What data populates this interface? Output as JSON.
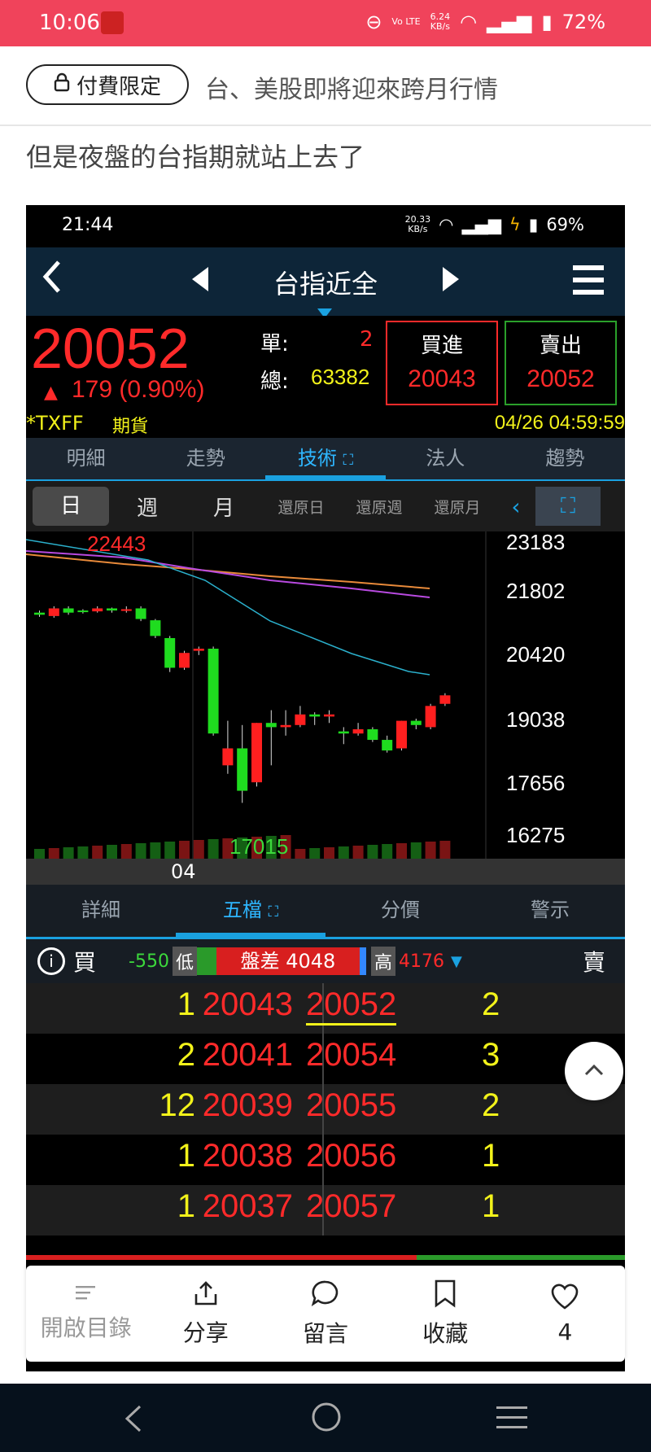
{
  "status": {
    "time": "10:06",
    "net_speed": "6.24",
    "net_unit": "KB/s",
    "volte": "Vo LTE",
    "battery": "72%"
  },
  "article": {
    "badge": "付費限定",
    "title": "台、美股即將迎來跨月行情",
    "text": "但是夜盤的台指期就站上去了"
  },
  "inner_status": {
    "time": "21:44",
    "speed": "20.33",
    "speed_unit": "KB/s",
    "battery": "69%"
  },
  "app": {
    "title": "台指近全",
    "price": "20052",
    "change": "179 (0.90%)",
    "single_label": "單:",
    "single_val": "2",
    "total_label": "總:",
    "total_val": "63382",
    "buy_label": "買進",
    "buy_price": "20043",
    "sell_label": "賣出",
    "sell_price": "20052",
    "symbol": "*TXFF",
    "type": "期貨",
    "datetime": "04/26 04:59:59"
  },
  "tabs": [
    "明細",
    "走勢",
    "技術",
    "法人",
    "趨勢"
  ],
  "periods": [
    "日",
    "週",
    "月",
    "還原日",
    "還原週",
    "還原月"
  ],
  "chart_data": {
    "type": "candlestick",
    "y_ticks": [
      "23183",
      "21802",
      "20420",
      "19038",
      "17656",
      "16275"
    ],
    "annotations": {
      "high": "22443",
      "low": "17015"
    },
    "x_label": "04",
    "candles": [
      {
        "o": 21500,
        "c": 21450,
        "h": 21550,
        "l": 21400
      },
      {
        "o": 21420,
        "c": 21600,
        "h": 21650,
        "l": 21380
      },
      {
        "o": 21600,
        "c": 21500,
        "h": 21650,
        "l": 21450
      },
      {
        "o": 21550,
        "c": 21530,
        "h": 21580,
        "l": 21480
      },
      {
        "o": 21530,
        "c": 21600,
        "h": 21650,
        "l": 21500
      },
      {
        "o": 21600,
        "c": 21550,
        "h": 21620,
        "l": 21500
      },
      {
        "o": 21560,
        "c": 21580,
        "h": 21650,
        "l": 21500
      },
      {
        "o": 21600,
        "c": 21350,
        "h": 21650,
        "l": 21300
      },
      {
        "o": 21320,
        "c": 20950,
        "h": 21350,
        "l": 20900
      },
      {
        "o": 20900,
        "c": 20200,
        "h": 20950,
        "l": 20100
      },
      {
        "o": 20200,
        "c": 20550,
        "h": 20600,
        "l": 20150
      },
      {
        "o": 20600,
        "c": 20650,
        "h": 20700,
        "l": 20500
      },
      {
        "o": 20650,
        "c": 18650,
        "h": 20700,
        "l": 18600
      },
      {
        "o": 17900,
        "c": 18300,
        "h": 18950,
        "l": 17700
      },
      {
        "o": 18300,
        "c": 17300,
        "h": 18850,
        "l": 17015
      },
      {
        "o": 17500,
        "c": 18900,
        "h": 18900,
        "l": 17400
      },
      {
        "o": 18900,
        "c": 18800,
        "h": 19200,
        "l": 17900
      },
      {
        "o": 18800,
        "c": 18850,
        "h": 19200,
        "l": 18600
      },
      {
        "o": 18850,
        "c": 19100,
        "h": 19300,
        "l": 18800
      },
      {
        "o": 19100,
        "c": 19050,
        "h": 19150,
        "l": 18850
      },
      {
        "o": 19050,
        "c": 19100,
        "h": 19200,
        "l": 18900
      },
      {
        "o": 18700,
        "c": 18650,
        "h": 18800,
        "l": 18400
      },
      {
        "o": 18650,
        "c": 18750,
        "h": 18900,
        "l": 18600
      },
      {
        "o": 18750,
        "c": 18500,
        "h": 18800,
        "l": 18450
      },
      {
        "o": 18500,
        "c": 18250,
        "h": 18600,
        "l": 18200
      },
      {
        "o": 18300,
        "c": 18950,
        "h": 18950,
        "l": 18250
      },
      {
        "o": 18950,
        "c": 18850,
        "h": 19000,
        "l": 18750
      },
      {
        "o": 18800,
        "c": 19300,
        "h": 19350,
        "l": 18750
      },
      {
        "o": 19350,
        "c": 19550,
        "h": 19600,
        "l": 19300
      }
    ],
    "ylim": [
      16275,
      23183
    ]
  },
  "five": {
    "tabs": [
      "詳細",
      "五檔",
      "分價",
      "警示"
    ],
    "buy_label": "買",
    "sell_label": "賣",
    "low_diff": "-550",
    "low_label": "低",
    "spread": "盤差 4048",
    "high_label": "高",
    "high_val": "4176",
    "rows": [
      {
        "bq": "1",
        "bp": "20043",
        "ap": "20052",
        "aq": "2"
      },
      {
        "bq": "2",
        "bp": "20041",
        "ap": "20054",
        "aq": "3"
      },
      {
        "bq": "12",
        "bp": "20039",
        "ap": "20055",
        "aq": "2"
      },
      {
        "bq": "1",
        "bp": "20038",
        "ap": "20056",
        "aq": "1"
      },
      {
        "bq": "1",
        "bp": "20037",
        "ap": "20057",
        "aq": "1"
      }
    ]
  },
  "bottom": {
    "toc": "開啟目錄",
    "share": "分享",
    "comment": "留言",
    "save": "收藏",
    "likes": "4"
  }
}
